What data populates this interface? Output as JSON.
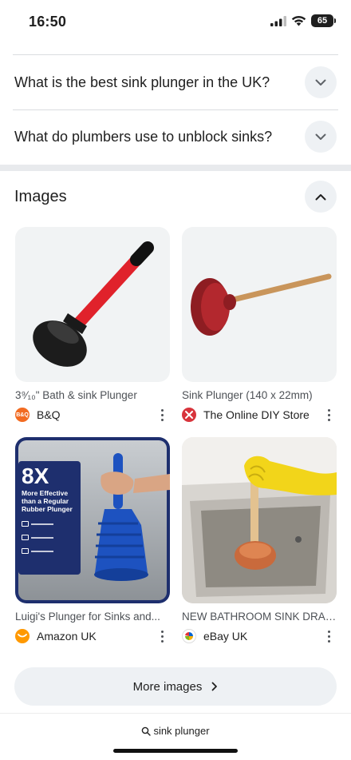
{
  "status_bar": {
    "time": "16:50",
    "battery": "65"
  },
  "faq": [
    {
      "question": "What is the best sink plunger in the UK?"
    },
    {
      "question": "What do plumbers use to unblock sinks?"
    }
  ],
  "images_section": {
    "title": "Images",
    "results": [
      {
        "caption": "3⁹⁄₁₀\" Bath & sink Plunger",
        "source": "B&Q",
        "favicon_text": "B&Q",
        "favicon_color": "#f26b21"
      },
      {
        "caption": "Sink Plunger (140 x 22mm)",
        "source": "The Online DIY Store",
        "favicon_color": "#d8343c"
      },
      {
        "caption": "Luigi's Plunger for Sinks and...",
        "source": "Amazon UK",
        "favicon_color": "#ff9900",
        "ad": {
          "big": "8X",
          "text": "More Effective than a Regular Rubber Plunger"
        }
      },
      {
        "caption": "NEW BATHROOM SINK DRAI...",
        "source": "eBay UK"
      }
    ],
    "more_label": "More images"
  },
  "bottom_bar": {
    "query": "sink plunger"
  },
  "colors": {
    "chip_bg": "#eef1f4",
    "divider": "#dadce0",
    "text": "#1f1f1f",
    "secondary_text": "#4d5156"
  }
}
